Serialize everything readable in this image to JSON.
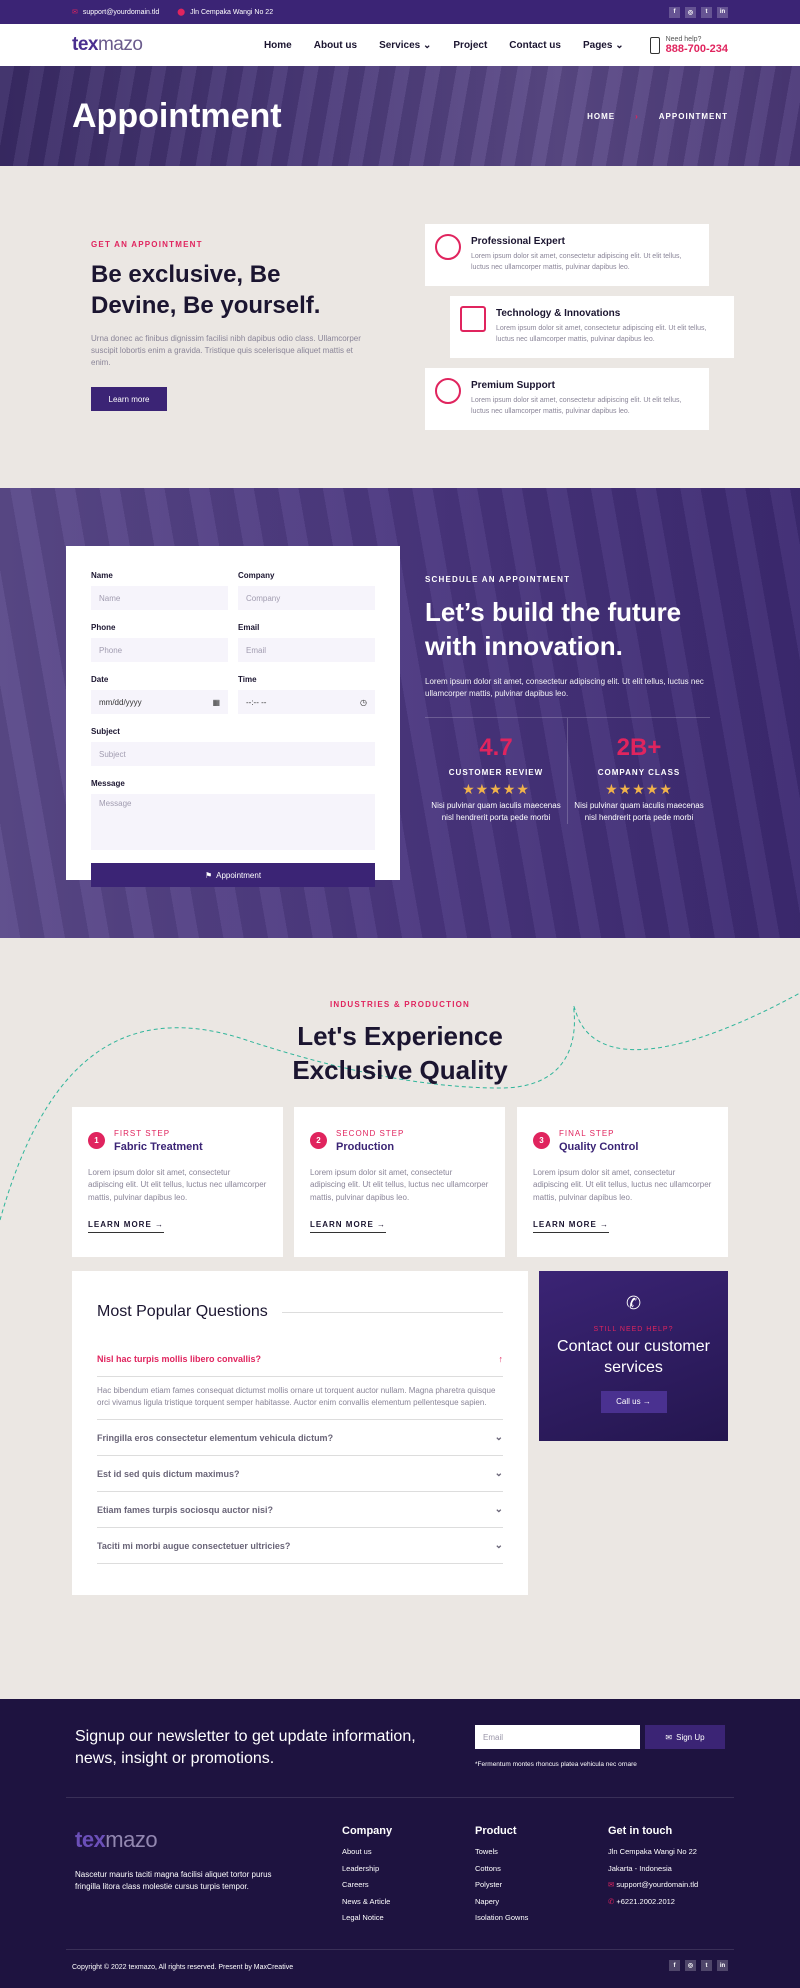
{
  "topbar": {
    "email": "support@yourdomain.tld",
    "address": "Jln Cempaka Wangi No 22",
    "social": [
      "f",
      "◎",
      "t",
      "in"
    ]
  },
  "nav": {
    "logo_a": "tex",
    "logo_b": "mazo",
    "items": [
      "Home",
      "About us",
      "Services",
      "Project",
      "Contact us",
      "Pages"
    ],
    "help_label": "Need help?",
    "help_phone": "888-700-234"
  },
  "hero": {
    "title": "Appointment",
    "crumb_home": "HOME",
    "crumb_current": "APPOINTMENT"
  },
  "intro": {
    "kicker": "GET AN APPOINTMENT",
    "title": "Be exclusive, Be Devine, Be yourself.",
    "text": "Urna donec ac finibus dignissim facilisi nibh dapibus odio class. Ullamcorper suscipit lobortis enim a gravida. Tristique quis scelerisque aliquet mattis et enim.",
    "button": "Learn more",
    "cards": [
      {
        "title": "Professional Expert",
        "text": "Lorem ipsum dolor sit amet, consectetur adipiscing elit. Ut elit tellus, luctus nec ullamcorper mattis, pulvinar dapibus leo."
      },
      {
        "title": "Technology & Innovations",
        "text": "Lorem ipsum dolor sit amet, consectetur adipiscing elit. Ut elit tellus, luctus nec ullamcorper mattis, pulvinar dapibus leo."
      },
      {
        "title": "Premium Support",
        "text": "Lorem ipsum dolor sit amet, consectetur adipiscing elit. Ut elit tellus, luctus nec ullamcorper mattis, pulvinar dapibus leo."
      }
    ]
  },
  "form": {
    "name_label": "Name",
    "name_ph": "Name",
    "company_label": "Company",
    "company_ph": "Company",
    "phone_label": "Phone",
    "phone_ph": "Phone",
    "email_label": "Email",
    "email_ph": "Email",
    "date_label": "Date",
    "date_value": "mm/dd/yyyy",
    "time_label": "Time",
    "time_value": "--:-- --",
    "subject_label": "Subject",
    "subject_ph": "Subject",
    "message_label": "Message",
    "message_ph": "Message",
    "submit": "Appointment"
  },
  "schedule": {
    "kicker": "SCHEDULE AN APPOINTMENT",
    "title": "Let’s build the future with innovation.",
    "text": "Lorem ipsum dolor sit amet, consectetur adipiscing elit. Ut elit tellus, luctus nec ullamcorper mattis, pulvinar dapibus leo.",
    "stats": [
      {
        "value": "4.7",
        "label": "CUSTOMER REVIEW",
        "stars": "★★★★★",
        "text": "Nisi pulvinar quam iaculis maecenas nisl hendrerit porta pede morbi"
      },
      {
        "value": "2B+",
        "label": "COMPANY CLASS",
        "stars": "★★★★★",
        "text": "Nisi pulvinar quam iaculis maecenas nisl hendrerit porta pede morbi"
      }
    ]
  },
  "process": {
    "kicker": "INDUSTRIES & PRODUCTION",
    "title": "Let's Experience Exclusive Quality",
    "steps": [
      {
        "num": "1",
        "kicker": "FIRST STEP",
        "title": "Fabric Treatment",
        "text": "Lorem ipsum dolor sit amet, consectetur adipiscing elit. Ut elit tellus, luctus nec ullamcorper mattis, pulvinar dapibus leo.",
        "link": "LEARN MORE →"
      },
      {
        "num": "2",
        "kicker": "SECOND STEP",
        "title": "Production",
        "text": "Lorem ipsum dolor sit amet, consectetur adipiscing elit. Ut elit tellus, luctus nec ullamcorper mattis, pulvinar dapibus leo.",
        "link": "LEARN MORE →"
      },
      {
        "num": "3",
        "kicker": "FINAL STEP",
        "title": "Quality Control",
        "text": "Lorem ipsum dolor sit amet, consectetur adipiscing elit. Ut elit tellus, luctus nec ullamcorper mattis, pulvinar dapibus leo.",
        "link": "LEARN MORE →"
      }
    ]
  },
  "faq": {
    "title": "Most Popular Questions",
    "open_q": "Nisl hac turpis mollis libero convallis?",
    "open_a": "Hac bibendum etiam fames consequat dictumst mollis ornare ut torquent auctor nullam. Magna pharetra quisque orci vivamus ligula tristique torquent semper habitasse. Auctor enim convallis elementum pellentesque sapien.",
    "questions": [
      "Fringilla eros consectetur elementum vehicula dictum?",
      "Est id sed quis dictum maximus?",
      "Etiam fames turpis sociosqu auctor nisi?",
      "Taciti mi morbi augue consectetuer ultricies?"
    ]
  },
  "contact": {
    "kicker": "STILL NEED HELP?",
    "title": "Contact our customer services",
    "button": "Call us →"
  },
  "footer": {
    "newsletter": "Signup our newsletter to get update information, news, insight or promotions.",
    "email_ph": "Email",
    "signup": "Sign Up",
    "note": "*Fermentum montes rhoncus platea vehicula nec ornare",
    "desc": "Nascetur mauris taciti magna facilisi aliquet tortor purus fringilla litora class molestie cursus turpis tempor.",
    "company_title": "Company",
    "company_links": [
      "About us",
      "Leadership",
      "Careers",
      "News & Article",
      "Legal Notice"
    ],
    "product_title": "Product",
    "product_links": [
      "Towels",
      "Cottons",
      "Polyster",
      "Napery",
      "Isolation Gowns"
    ],
    "touch_title": "Get in touch",
    "touch_items": [
      "Jln Cempaka Wangi No 22",
      "Jakarta - Indonesia",
      "support@yourdomain.tld",
      "+6221.2002.2012"
    ],
    "copyright": "Copyright © 2022 texmazo, All rights reserved. Present by MaxCreative"
  },
  "colors": {
    "primary": "#3b2475",
    "accent": "#e0245e",
    "background": "#ebe7e3",
    "footer": "#1e1340"
  }
}
